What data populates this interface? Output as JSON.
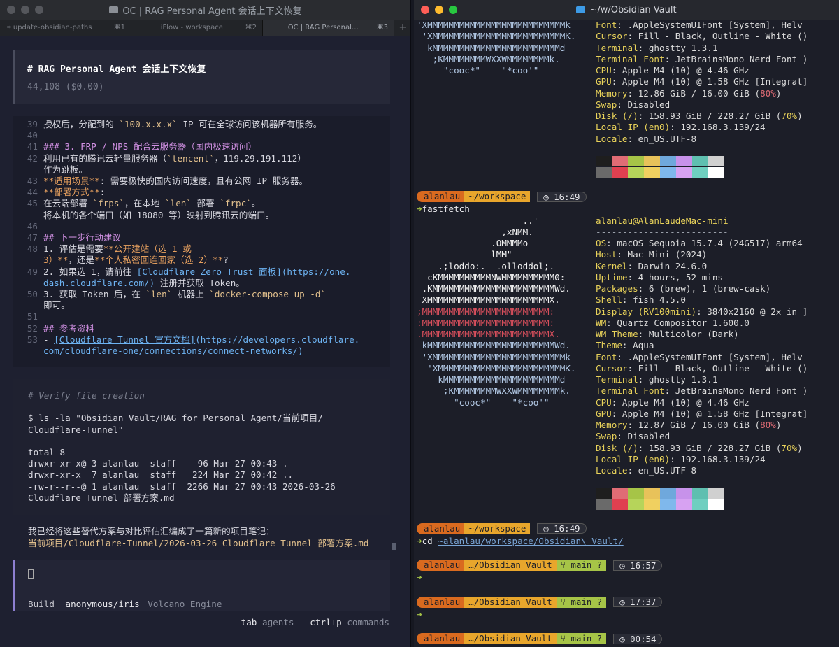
{
  "left": {
    "title": "OC | RAG Personal Agent 会话上下文恢复",
    "tabs": [
      {
        "label": "update-obsidian-paths",
        "shortcut": "⌘1",
        "icon": "terminal-icon"
      },
      {
        "label": "iFlow - workspace",
        "shortcut": "⌘2"
      },
      {
        "label": "OC | RAG Personal…",
        "shortcut": "⌘3"
      }
    ],
    "new_tab": "+",
    "session_heading": "# RAG Personal Agent 会话上下文恢复",
    "tokens": "44,108 ($0.00)",
    "code": {
      "l39": {
        "n": "39",
        "a": "授权后，分配到的 ",
        "b": "`100.x.x.x`",
        "c": " IP 可在全球访问该机器所有服务。"
      },
      "l40": {
        "n": "40"
      },
      "l41": {
        "n": "41",
        "a": "### 3. FRP / NPS 配合云服务器（国内极速访问）"
      },
      "l42": {
        "n": "42",
        "a": "利用已有的腾讯云轻量服务器（",
        "b": "`tencent`",
        "c": "，119.29.191.112）"
      },
      "l42b": {
        "a": "作为跳板。"
      },
      "l43": {
        "n": "43",
        "a": "**适用场景**",
        "b": ": 需要极快的国内访问速度，且有公网 IP 服务器。"
      },
      "l44": {
        "n": "44",
        "a": "**部署方式**",
        "b": ":"
      },
      "l45": {
        "n": "45",
        "a": "在云端部署 ",
        "b": "`frps`",
        "c": "，在本地 ",
        "d": "`len`",
        "e": " 部署 ",
        "f": "`frpc`",
        "g": "。"
      },
      "l45b": {
        "a": "将本机的各个端口（如 18080 等）映射到腾讯云的端口。"
      },
      "l46": {
        "n": "46"
      },
      "l47": {
        "n": "47",
        "a": "## 下一步行动建议"
      },
      "l48": {
        "n": "48",
        "a": "1. 评估是需要",
        "b": "**公开建站（选 1 或"
      },
      "l48b": {
        "a": "3）**",
        "b": "，还是",
        "c": "**个人私密回连回家（选 2）**",
        "d": "?"
      },
      "l49": {
        "n": "49",
        "a": "2. 如果选 1，请前往 ",
        "b": "[Cloudflare Zero Trust 面板]",
        "c": "(https://one."
      },
      "l49b": {
        "a": "dash.cloudflare.com/)",
        "b": " 注册并获取 Token。"
      },
      "l50": {
        "n": "50",
        "a": "3. 获取 Token 后，在 ",
        "b": "`len`",
        "c": " 机器上 ",
        "d": "`docker-compose up -d`"
      },
      "l50b": {
        "a": "即可。"
      },
      "l51": {
        "n": "51"
      },
      "l52": {
        "n": "52",
        "a": "## 参考资料"
      },
      "l53": {
        "n": "53",
        "a": "- ",
        "b": "[Cloudflare Tunnel 官方文档]",
        "c": "(https://developers.cloudflare."
      },
      "l53b": {
        "a": "com/cloudflare-one/connections/connect-networks/)"
      }
    },
    "shell": {
      "comment": "# Verify file creation",
      "cmd1": "$ ls -la \"Obsidian Vault/RAG for Personal Agent/当前项目/",
      "cmd2": "Cloudflare-Tunnel\"",
      "total": "total 8",
      "row1": "drwxr-xr-x@ 3 alanlau  staff    96 Mar 27 00:43 .",
      "row2": "drwxr-xr-x  7 alanlau  staff   224 Mar 27 00:42 ..",
      "row3": "-rw-r--r--@ 1 alanlau  staff  2266 Mar 27 00:43 2026-03-26",
      "row4": "Cloudflare Tunnel 部署方案.md"
    },
    "message": {
      "line1": "我已经将这些替代方案与对比评估汇编成了一篇新的项目笔记：",
      "line2": "当前项目/Cloudflare-Tunnel/2026-03-26 Cloudflare Tunnel 部署方案.md"
    },
    "input": {
      "mode": "Build",
      "model": "anonymous/iris",
      "provider": "Volcano Engine"
    },
    "hints": {
      "k1": "tab",
      "v1": "agents",
      "k2": "ctrl+p",
      "v2": "commands"
    }
  },
  "right": {
    "title": "~/w/Obsidian Vault",
    "block1": {
      "logo": [
        "'XMMMMMMMMMMMMMMMMMMMMMMMMMMk",
        " 'XMMMMMMMMMMMMMMMMMMMMMMMMMK.",
        "  kMMMMMMMMMMMMMMMMMMMMMMMMd",
        "   ;KMMMMMMMMWXXWMMMMMMMMk.",
        "     \"cooc*\"    \"*coo'\""
      ],
      "info": [
        {
          "k": "Font",
          "v": ": .AppleSystemUIFont [System], Helv"
        },
        {
          "k": "Cursor",
          "v": ": Fill - Black, Outline - White ()"
        },
        {
          "k": "Terminal",
          "v": ": ghostty 1.3.1"
        },
        {
          "k": "Terminal Font",
          "v": ": JetBrainsMono Nerd Font )"
        },
        {
          "k": "CPU",
          "v": ": Apple M4 (10) @ 4.46 GHz"
        },
        {
          "k": "GPU",
          "v": ": Apple M4 (10) @ 1.58 GHz [Integrat]"
        },
        {
          "k": "Memory",
          "v": ": 12.86 GiB / 16.00 GiB (",
          "p": "80%",
          "e": ")"
        },
        {
          "k": "Swap",
          "v": ": Disabled"
        },
        {
          "k": "Disk (/)",
          "v": ": 158.93 GiB / 228.27 GiB (",
          "p2": "70%",
          "e": ")"
        },
        {
          "k": "Local IP (en0)",
          "v": ": 192.168.3.139/24"
        },
        {
          "k": "Locale",
          "v": ": en_US.UTF-8"
        }
      ]
    },
    "palette_top": [
      "#1e1e1e",
      "#e06c75",
      "#a6c447",
      "#e8c25a",
      "#6fa8dc",
      "#c792ea",
      "#5fbfb0",
      "#d0d0d0"
    ],
    "palette_bottom": [
      "#6a6a6a",
      "#e04050",
      "#b6d45a",
      "#f0d060",
      "#7fb8ec",
      "#d7a2f2",
      "#6fcfc0",
      "#ffffff"
    ],
    "prompt1": {
      "user": "alanlau",
      "dir": "~/workspace",
      "time": "16:49",
      "cmd": "fastfetch"
    },
    "block2": {
      "logo": [
        "                    ..'",
        "                ,xNMM.",
        "              .OMMMMo",
        "              lMM\"",
        "    .;loddo:.  .olloddol;.",
        "  cKMMMMMMMMMMNWMMMMMMMMMM0:",
        " .KMMMMMMMMMMMMMMMMMMMMMMMWd.",
        " XMMMMMMMMMMMMMMMMMMMMMMMX.",
        ";MMMMMMMMMMMMMMMMMMMMMMMM:",
        ":MMMMMMMMMMMMMMMMMMMMMMMM:",
        ".MMMMMMMMMMMMMMMMMMMMMMMMX.",
        " kMMMMMMMMMMMMMMMMMMMMMMMMWd.",
        " 'XMMMMMMMMMMMMMMMMMMMMMMMMMk",
        "  'XMMMMMMMMMMMMMMMMMMMMMMMMK.",
        "    kMMMMMMMMMMMMMMMMMMMMMMd",
        "     ;KMMMMMMMMWXXWMMMMMMMMk.",
        "       \"cooc*\"    \"*coo'\""
      ],
      "header": "alanlau@AlanLaudeMac-mini",
      "rule": "-------------------------",
      "info": [
        {
          "k": "OS",
          "v": ": macOS Sequoia 15.7.4 (24G517) arm64"
        },
        {
          "k": "Host",
          "v": ": Mac Mini (2024)"
        },
        {
          "k": "Kernel",
          "v": ": Darwin 24.6.0"
        },
        {
          "k": "Uptime",
          "v": ": 4 hours, 52 mins"
        },
        {
          "k": "Packages",
          "v": ": 6 (brew), 1 (brew-cask)"
        },
        {
          "k": "Shell",
          "v": ": fish 4.5.0"
        },
        {
          "k": "Display (RV100mini)",
          "v": ": 3840x2160 @ 2x in ]"
        },
        {
          "k": "WM",
          "v": ": Quartz Compositor 1.600.0"
        },
        {
          "k": "WM Theme",
          "v": ": Multicolor (Dark)"
        },
        {
          "k": "Theme",
          "v": ": Aqua"
        },
        {
          "k": "Font",
          "v": ": .AppleSystemUIFont [System], Helv"
        },
        {
          "k": "Cursor",
          "v": ": Fill - Black, Outline - White ()"
        },
        {
          "k": "Terminal",
          "v": ": ghostty 1.3.1"
        },
        {
          "k": "Terminal Font",
          "v": ": JetBrainsMono Nerd Font )"
        },
        {
          "k": "CPU",
          "v": ": Apple M4 (10) @ 4.46 GHz"
        },
        {
          "k": "GPU",
          "v": ": Apple M4 (10) @ 1.58 GHz [Integrat]"
        },
        {
          "k": "Memory",
          "v": ": 12.87 GiB / 16.00 GiB (",
          "p": "80%",
          "e": ")"
        },
        {
          "k": "Swap",
          "v": ": Disabled"
        },
        {
          "k": "Disk (/)",
          "v": ": 158.93 GiB / 228.27 GiB (",
          "p2": "70%",
          "e": ")"
        },
        {
          "k": "Local IP (en0)",
          "v": ": 192.168.3.139/24"
        },
        {
          "k": "Locale",
          "v": ": en_US.UTF-8"
        }
      ]
    },
    "prompt2": {
      "user": "alanlau",
      "dir": "~/workspace",
      "time": "16:49",
      "cmd": "cd ",
      "path": "~alanlau/workspace/Obsidian\\ Vault/"
    },
    "prompt3": {
      "user": "alanlau",
      "dir": "…/Obsidian Vault",
      "git": "main ?",
      "time": "16:57"
    },
    "prompt4": {
      "user": "alanlau",
      "dir": "…/Obsidian Vault",
      "git": "main ?",
      "time": "17:37"
    },
    "prompt5": {
      "user": "alanlau",
      "dir": "…/Obsidian Vault",
      "git": "main ?",
      "time": "00:54"
    },
    "arrow": "➜"
  }
}
